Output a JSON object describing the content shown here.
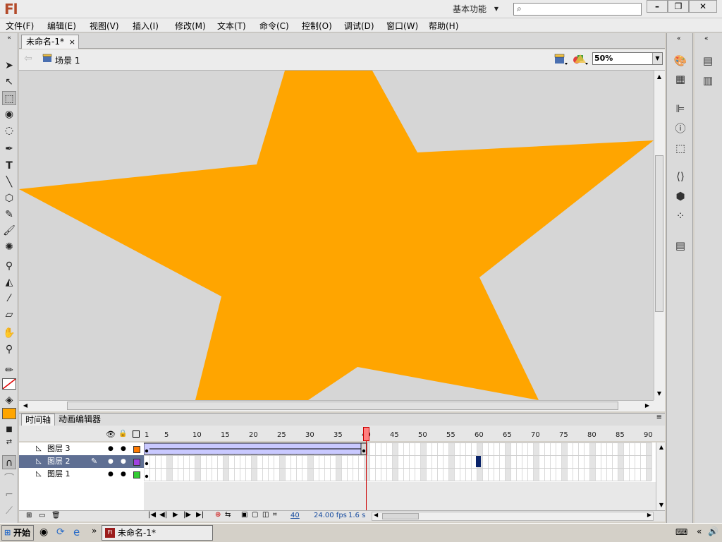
{
  "app": {
    "logo": "Fl",
    "workspace": "基本功能",
    "search_placeholder": ""
  },
  "menus": [
    "文件(F)",
    "编辑(E)",
    "视图(V)",
    "插入(I)",
    "修改(M)",
    "文本(T)",
    "命令(C)",
    "控制(O)",
    "调试(D)",
    "窗口(W)",
    "帮助(H)"
  ],
  "document": {
    "tab_title": "未命名-1*",
    "scene": "场景 1",
    "zoom": "50%"
  },
  "stage": {
    "background": "#d6d6d6",
    "star_color": "#ffa500"
  },
  "timeline": {
    "tabs": [
      "时间轴",
      "动画编辑器"
    ],
    "frame_numbers": [
      "1",
      "5",
      "10",
      "15",
      "20",
      "25",
      "30",
      "35",
      "40",
      "45",
      "50",
      "55",
      "60",
      "65",
      "70",
      "75",
      "80",
      "85",
      "90"
    ],
    "playhead_frame": 40,
    "layers": [
      {
        "name": "图层 3",
        "color": "#ff7a00",
        "selected": false
      },
      {
        "name": "图层 2",
        "color": "#a040e0",
        "selected": true
      },
      {
        "name": "图层 1",
        "color": "#33cc33",
        "selected": false
      }
    ],
    "status": {
      "current_frame": "40",
      "fps": "24.00 fps",
      "time": "1.6 s"
    }
  },
  "taskbar": {
    "start": "开始",
    "item": "未命名-1*"
  },
  "colors": {
    "fill": "#ffa500",
    "stroke": "none"
  }
}
